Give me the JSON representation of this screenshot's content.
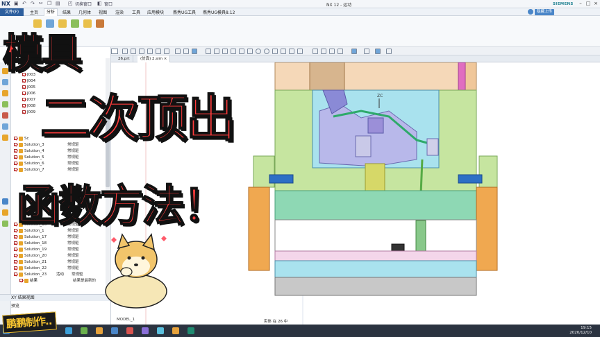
{
  "app": {
    "logo": "NX",
    "window_title": "NX 12 - 运动",
    "brand": "SIEMENS",
    "quick_access_window": "切换窗口",
    "quick_access_menu": "窗口",
    "cloud_button": "隐藏上传"
  },
  "menu": {
    "file": "文件(F)",
    "tabs": [
      "主页",
      "分析",
      "结果",
      "几何体",
      "视图",
      "渲染",
      "工具",
      "应用模块",
      "燕秀UG工具",
      "燕秀UG模具8.12"
    ],
    "active_tab": "分析"
  },
  "doc_tabs": [
    "26.prt",
    "(仿真) 2.sim"
  ],
  "navigator": {
    "motion_joints": [
      "J003",
      "J004",
      "J005",
      "J006",
      "J007",
      "J008",
      "J009"
    ],
    "solutions": [
      {
        "name": "Sc",
        "status": ""
      },
      {
        "name": "Solution_3",
        "status": "常规驱"
      },
      {
        "name": "Solution_4",
        "status": "常规驱"
      },
      {
        "name": "Solution_5",
        "status": "常规驱"
      },
      {
        "name": "Solution_6",
        "status": "常规驱"
      },
      {
        "name": "Solution_7",
        "status": "常规驱"
      },
      {
        "name": "Solution_16",
        "status": "常规驱"
      },
      {
        "name": "Solution_1",
        "status": "常规驱"
      },
      {
        "name": "Solution_17",
        "status": "常规驱"
      },
      {
        "name": "Solution_18",
        "status": "常规驱"
      },
      {
        "name": "Solution_19",
        "status": "常规驱"
      },
      {
        "name": "Solution_20",
        "status": "常规驱"
      },
      {
        "name": "Solution_21",
        "status": "常规驱"
      },
      {
        "name": "Solution_22",
        "status": "常规驱"
      },
      {
        "name": "Solution_23",
        "status": "常规驱",
        "flag": "活动"
      },
      {
        "name": "结果",
        "status": "结果是最新的"
      }
    ],
    "results_panel": "XY 结果视图",
    "preview": "预览"
  },
  "viewport": {
    "axis_label": "ZC",
    "view_label": "MODEL_1",
    "status": "实体 在 26 中"
  },
  "clock": {
    "time": "19:15",
    "date": "2020/12/10"
  },
  "overlay": {
    "line1": "模具",
    "line2": "二次顶出",
    "line3": "函数方法！",
    "credit": "鹏鹏制作.."
  },
  "colors": {
    "caption_fill": "#ff3b3b",
    "caption_outline": "#111111",
    "ribbon_active": "#2d5f9e",
    "mold_green": "#c6e5a0",
    "mold_orange": "#f0a850",
    "mold_cyan": "#a9e2ee"
  }
}
